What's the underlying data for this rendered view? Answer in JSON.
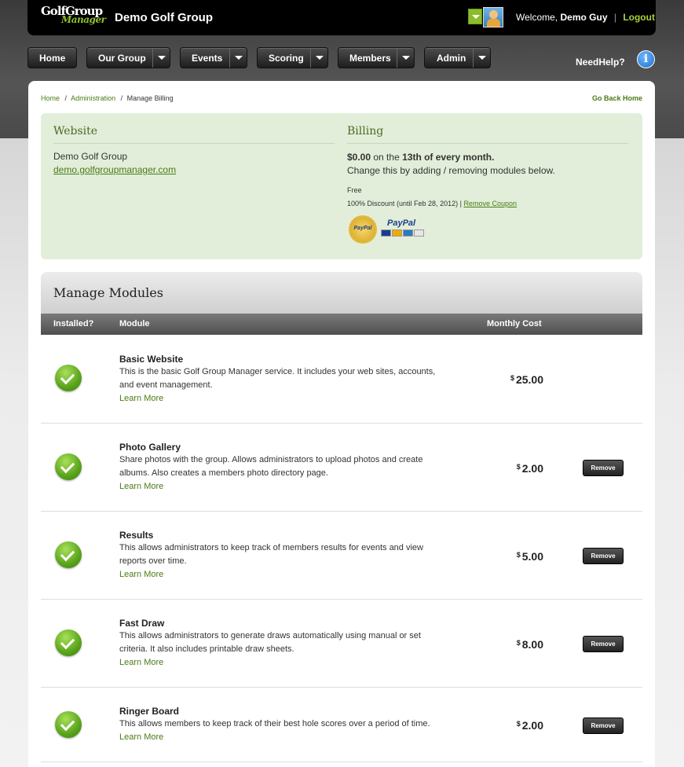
{
  "header": {
    "logo_line1": "GolfGroup",
    "logo_line2": "Manager",
    "site_title": "Demo Golf Group",
    "welcome_prefix": "Welcome,",
    "user_name": "Demo Guy",
    "separator": "|",
    "logout": "Logout"
  },
  "nav": {
    "home": "Home",
    "our_group": "Our Group",
    "events": "Events",
    "scoring": "Scoring",
    "members": "Members",
    "admin": "Admin",
    "need_help": "NeedHelp?",
    "help_icon": "i"
  },
  "breadcrumb": {
    "home": "Home",
    "sep1": "/",
    "admin": "Administration",
    "sep2": "/",
    "current": "Manage Billing",
    "go_back": "Go Back Home"
  },
  "website": {
    "heading": "Website",
    "name": "Demo Golf Group",
    "url": "demo.golfgroupmanager.com"
  },
  "billing": {
    "heading": "Billing",
    "amount": "$0.00",
    "on_the": "on the",
    "schedule": "13th of every month.",
    "change_text": "Change this by adding / removing modules below.",
    "plan": "Free",
    "discount": "100% Discount (until Feb 28, 2012) |",
    "remove_coupon": "Remove Coupon",
    "seal_text": "PayPal",
    "paypal_text": "PayPal"
  },
  "modules": {
    "title": "Manage Modules",
    "col_installed": "Installed?",
    "col_module": "Module",
    "col_cost": "Monthly Cost",
    "currency": "$",
    "learn_more": "Learn More",
    "remove_label": "Remove",
    "items": [
      {
        "name": "Basic Website",
        "desc": "This is the basic Golf Group Manager service. It includes your web sites, accounts, and event management.",
        "cost": "25.00"
      },
      {
        "name": "Photo Gallery",
        "desc": "Share photos with the group. Allows administrators to upload photos and create albums. Also creates a members photo directory page.",
        "cost": "2.00"
      },
      {
        "name": "Results",
        "desc": "This allows administrators to keep track of members results for events and view reports over time.",
        "cost": "5.00"
      },
      {
        "name": "Fast Draw",
        "desc": "This allows administrators to generate draws automatically using manual or set criteria. It also includes printable draw sheets.",
        "cost": "8.00"
      },
      {
        "name": "Ringer Board",
        "desc": "This allows members to keep track of their best hole scores over a period of time.",
        "cost": "2.00"
      }
    ]
  },
  "colors": {
    "accent_green": "#4a7a16",
    "info_bg": "#e2eed9",
    "check_green": "#58a41b"
  }
}
